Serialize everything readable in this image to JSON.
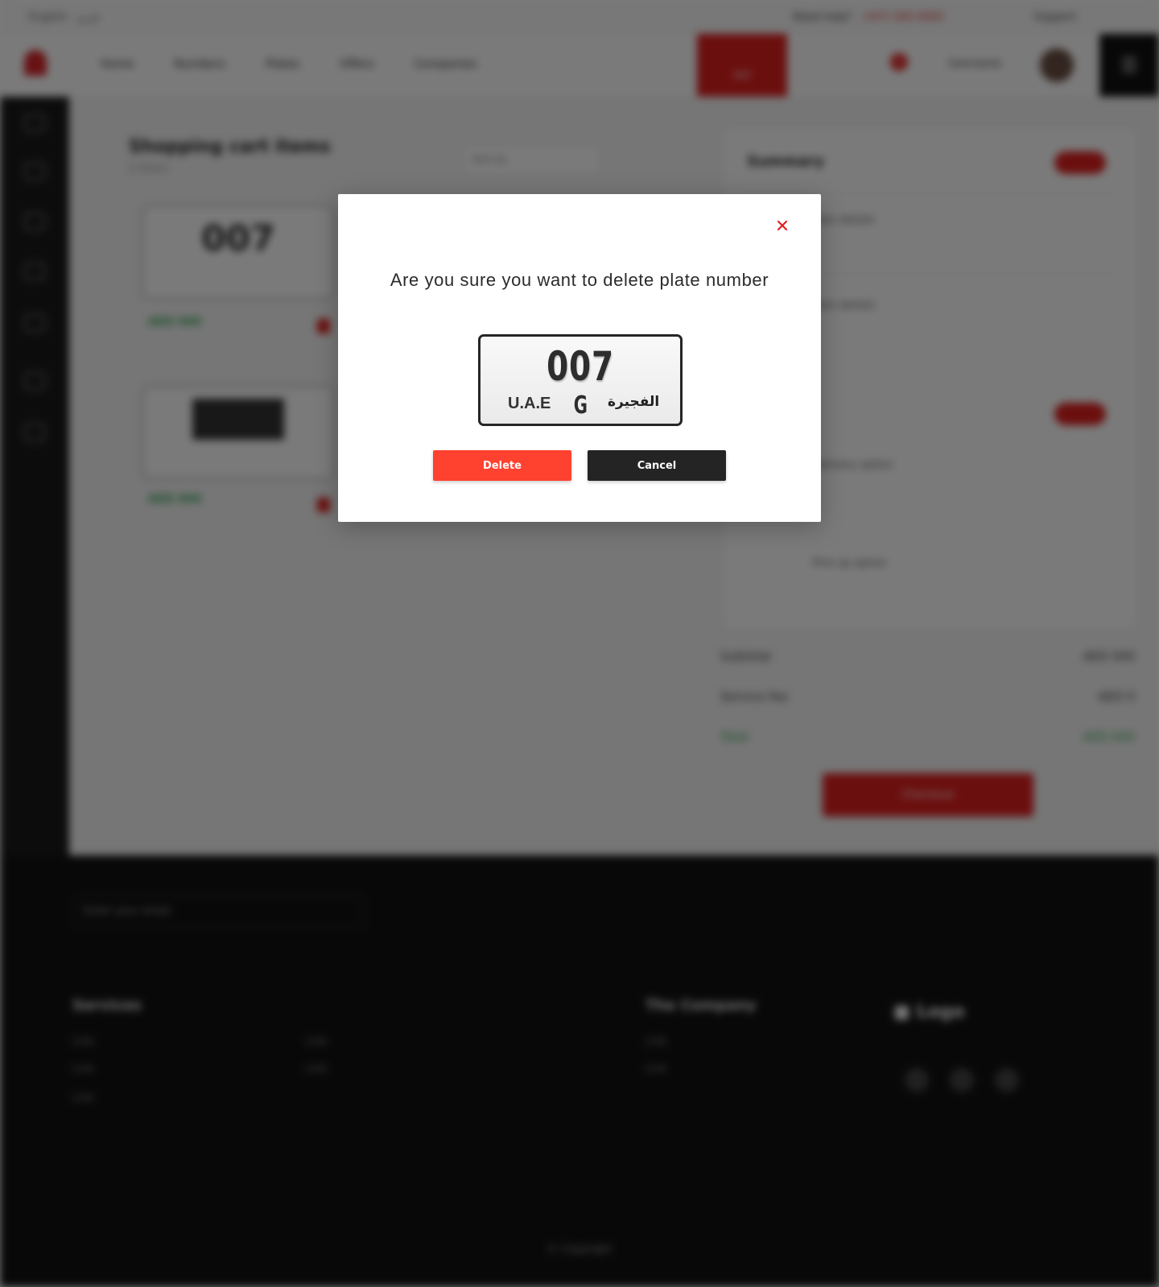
{
  "modal": {
    "title": "Are you sure you want to delete plate number",
    "delete_label": "Delete",
    "cancel_label": "Cancel",
    "close_icon": "close-icon",
    "plate": {
      "number": "007",
      "country": "U.A.E",
      "letter": "G",
      "emirate": "الفجيرة"
    }
  },
  "colors": {
    "delete_button": "#ff4130",
    "cancel_button": "#242424",
    "close_icon": "#e0201f",
    "accent": "#e0201f"
  }
}
